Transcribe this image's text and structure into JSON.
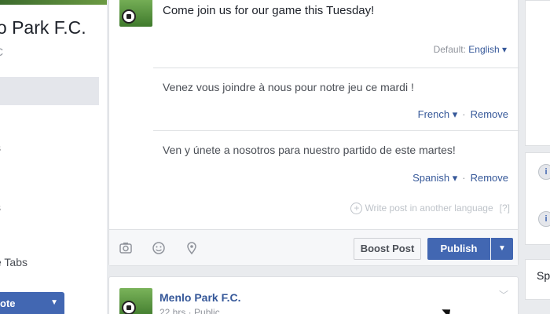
{
  "sidebar": {
    "page_name": "nlo Park F.C.",
    "page_handle": "C",
    "tabs_label": "e Tabs",
    "promote_label": "ote"
  },
  "composer": {
    "main_text": "Come join us for our game this Tuesday!",
    "default_prefix": "Default:",
    "default_lang": "English",
    "translations": [
      {
        "text": "Venez vous joindre à nous pour notre jeu ce mardi !",
        "language": "French",
        "remove_label": "Remove"
      },
      {
        "text": "Ven y únete a nosotros para nuestro partido de este martes!",
        "language": "Spanish",
        "remove_label": "Remove"
      }
    ],
    "write_another": "Write post in another language",
    "help": "[?]",
    "boost_label": "Boost Post",
    "publish_label": "Publish"
  },
  "post": {
    "name": "Menlo Park F.C.",
    "meta": "22 hrs · Public"
  },
  "right": {
    "sp_label": "Sp"
  },
  "colors": {
    "brand_blue": "#4267b2",
    "link_blue": "#365899",
    "page_bg": "#e9ebee"
  },
  "icons": [
    "camera-icon",
    "smiley-icon",
    "location-pin-icon",
    "caret-down-icon",
    "plus-circle-icon",
    "chevron-down-icon"
  ]
}
